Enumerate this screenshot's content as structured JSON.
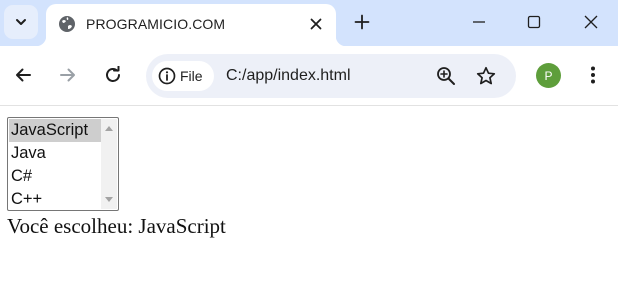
{
  "browser": {
    "tab": {
      "title": "PROGRAMICIO.COM"
    },
    "address_bar": {
      "chip_label": "File",
      "url": "C:/app/index.html"
    },
    "profile_initial": "P"
  },
  "page": {
    "listbox": {
      "options": [
        "JavaScript",
        "Java",
        "C#",
        "C++"
      ],
      "selected": "JavaScript"
    },
    "output_prefix": "Você escolheu: ",
    "output_value": "JavaScript"
  },
  "colors": {
    "titlebar": "#d3e3fd",
    "omnibox": "#edf0f8",
    "avatar": "#5e9e3b",
    "selected_option": "#cecece"
  }
}
